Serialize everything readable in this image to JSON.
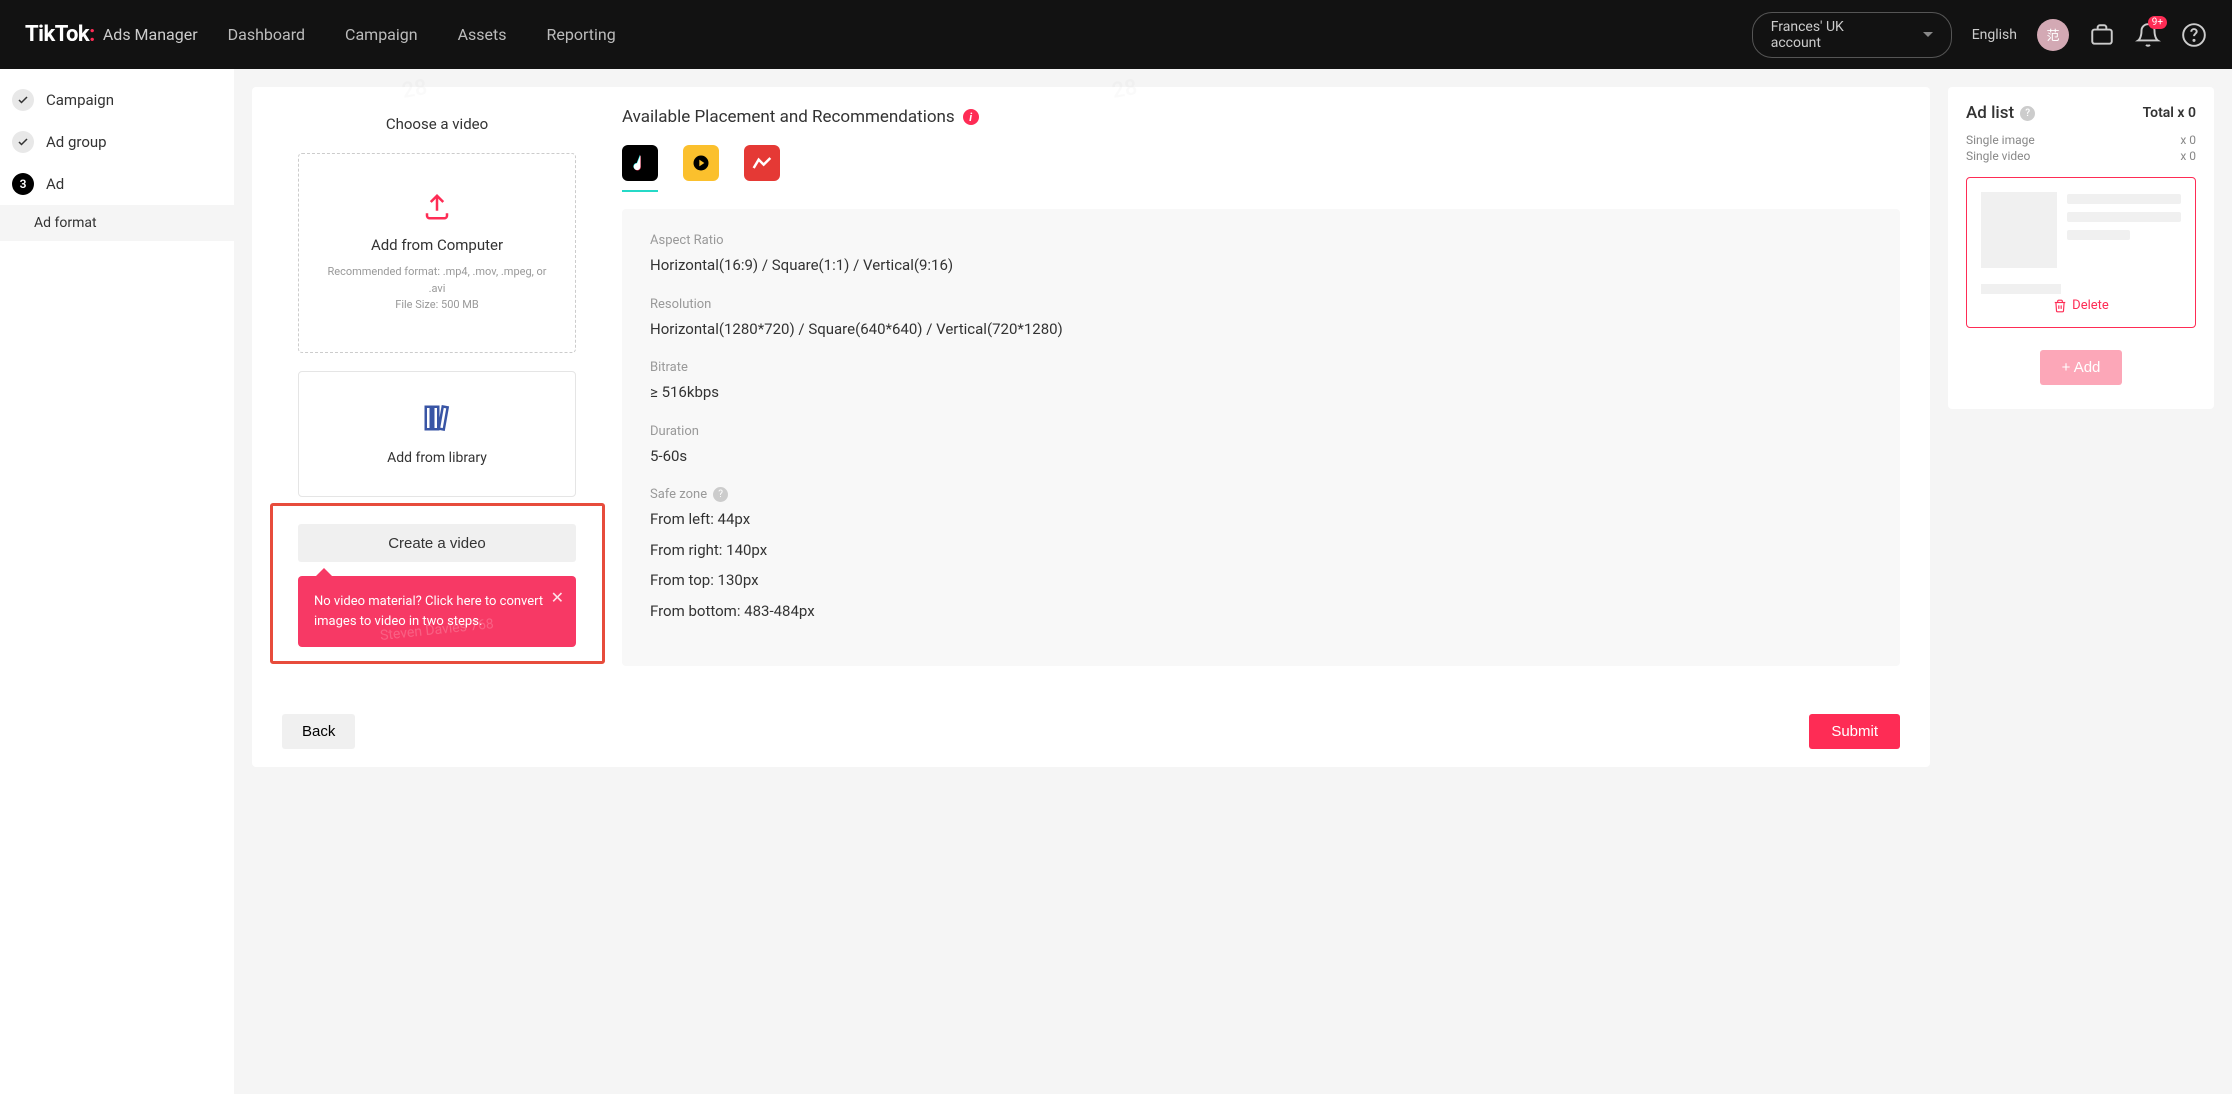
{
  "header": {
    "brand": "TikTok",
    "sub": "Ads Manager",
    "nav": [
      "Dashboard",
      "Campaign",
      "Assets",
      "Reporting"
    ],
    "account": "Frances' UK account",
    "language": "English",
    "avatar": "范",
    "notif_badge": "9+"
  },
  "sidebar": {
    "items": [
      {
        "label": "Campaign",
        "done": true
      },
      {
        "label": "Ad group",
        "done": true
      },
      {
        "label": "Ad",
        "num": "3"
      }
    ],
    "sub": "Ad format"
  },
  "video": {
    "title": "Choose a video",
    "upload_label": "Add from Computer",
    "upload_sub1": "Recommended format: .mp4, .mov, .mpeg, or .avi",
    "upload_sub2": "File Size: 500 MB",
    "library_label": "Add from library",
    "create_label": "Create a video",
    "tooltip": "No video material? Click here to convert images to video in two steps."
  },
  "specs": {
    "header": "Available Placement and Recommendations",
    "aspect_label": "Aspect Ratio",
    "aspect_value": "Horizontal(16:9) / Square(1:1) / Vertical(9:16)",
    "res_label": "Resolution",
    "res_value": "Horizontal(1280*720) / Square(640*640) / Vertical(720*1280)",
    "bitrate_label": "Bitrate",
    "bitrate_value": "≥ 516kbps",
    "duration_label": "Duration",
    "duration_value": "5-60s",
    "safezone_label": "Safe zone",
    "safezone": [
      "From left: 44px",
      "From right: 140px",
      "From top: 130px",
      "From bottom: 483-484px"
    ]
  },
  "footer": {
    "back": "Back",
    "submit": "Submit"
  },
  "adlist": {
    "title": "Ad list",
    "total": "Total x 0",
    "rows": [
      {
        "label": "Single image",
        "value": "x 0"
      },
      {
        "label": "Single video",
        "value": "x 0"
      }
    ],
    "delete": "Delete",
    "add": "+ Add"
  }
}
